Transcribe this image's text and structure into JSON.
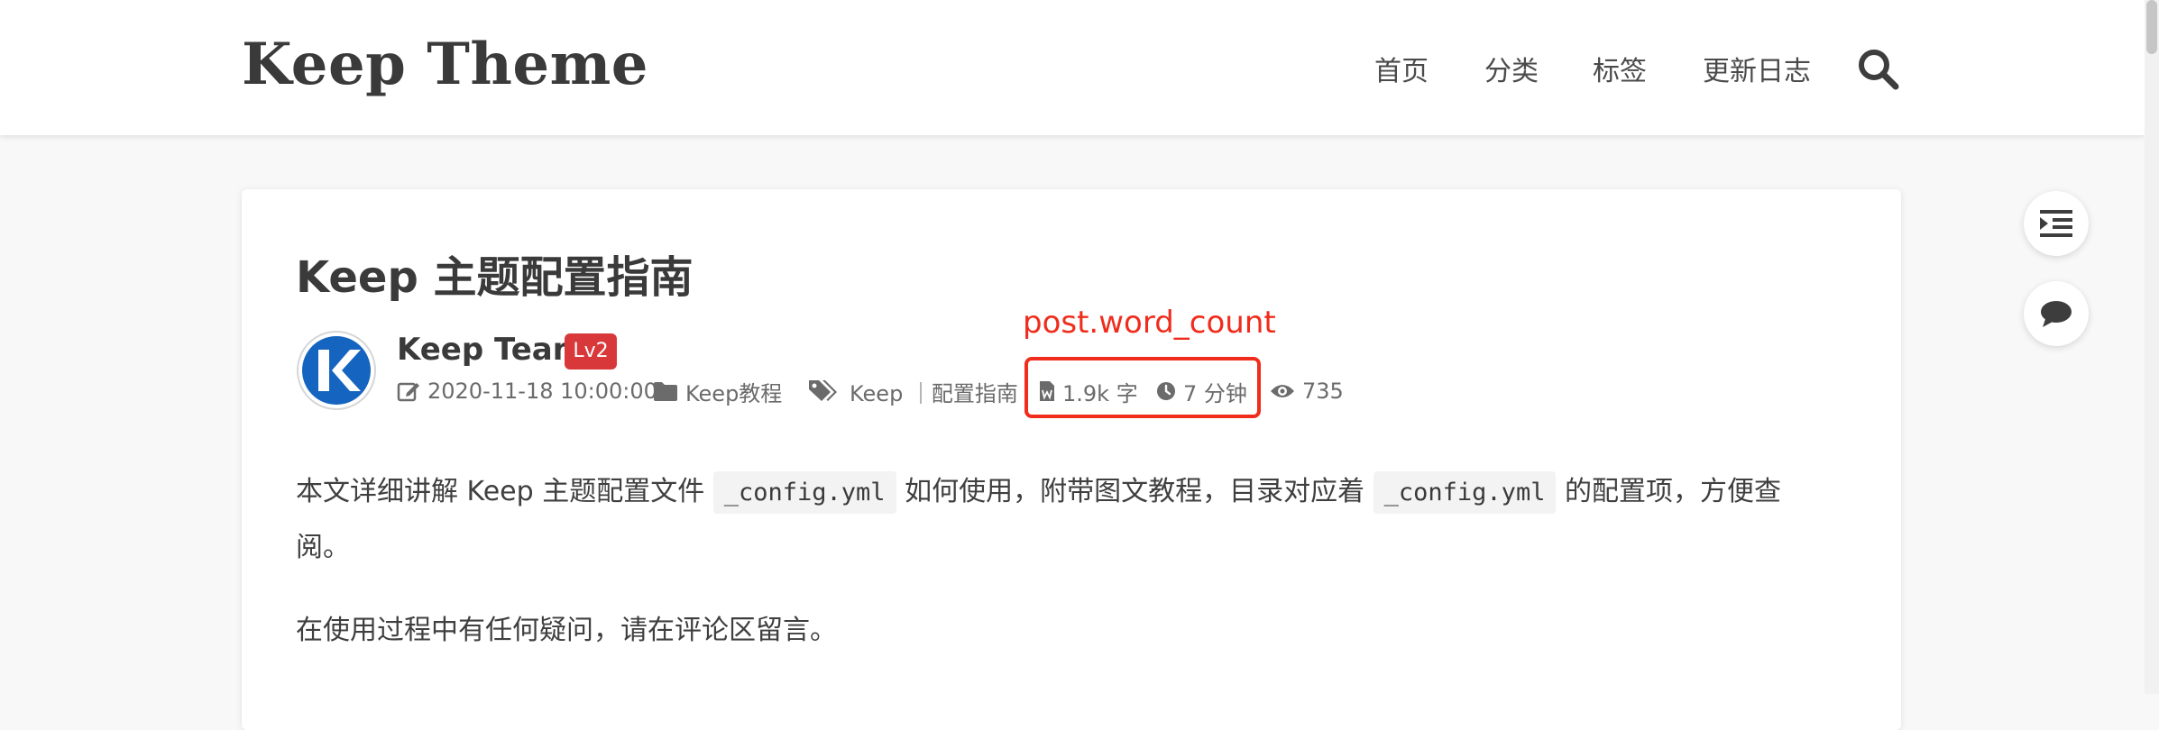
{
  "header": {
    "site_title": "Keep Theme",
    "nav": [
      {
        "label": "首页"
      },
      {
        "label": "分类"
      },
      {
        "label": "标签"
      },
      {
        "label": "更新日志"
      }
    ],
    "search_icon": "search-icon"
  },
  "post": {
    "title": "Keep 主题配置指南",
    "author": "Keep Team",
    "level": "Lv2",
    "date": "2020-11-18 10:00:00",
    "category": "Keep教程",
    "tags": "Keep ｜配置指南",
    "word_count": "1.9k 字",
    "reading_time": "7 分钟",
    "views": "735",
    "annotation": "post.word_count"
  },
  "content": {
    "p1_a": "本文详细讲解 Keep 主题配置文件 ",
    "p1_code1": "_config.yml",
    "p1_b": " 如何使用，附带图文教程，目录对应着 ",
    "p1_code2": "_config.yml",
    "p1_c": " 的配置项，方便查",
    "p1_d": "阅。",
    "p2": "在使用过程中有任何疑问，请在评论区留言。"
  },
  "colors": {
    "accent": "#d9383a",
    "annotation": "#f02c1c",
    "avatar_blue": "#1565c0"
  },
  "side_tools": [
    "toc-indent-icon",
    "comment-icon"
  ]
}
